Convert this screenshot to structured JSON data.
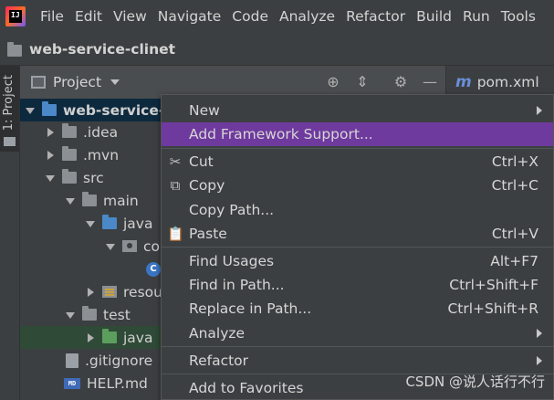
{
  "menubar": {
    "logo_text": "IJ",
    "items": [
      "File",
      "Edit",
      "View",
      "Navigate",
      "Code",
      "Analyze",
      "Refactor",
      "Build",
      "Run",
      "Tools"
    ]
  },
  "navbar": {
    "title": "web-service-clinet"
  },
  "side": {
    "tab_label": "1: Project"
  },
  "toolwindow": {
    "label": "Project"
  },
  "editor": {
    "tab_label": "pom.xml",
    "tab_icon": "m"
  },
  "tree": {
    "rows": [
      {
        "label": "web-service-c",
        "bold": true
      },
      {
        "label": ".idea"
      },
      {
        "label": ".mvn"
      },
      {
        "label": "src"
      },
      {
        "label": "main"
      },
      {
        "label": "java"
      },
      {
        "label": "co"
      },
      {
        "label": ""
      },
      {
        "label": "resou"
      },
      {
        "label": "test"
      },
      {
        "label": "java"
      },
      {
        "label": ".gitignore"
      },
      {
        "label": "HELP.md"
      }
    ]
  },
  "context_menu": {
    "items": [
      {
        "label": "New",
        "shortcut": ""
      },
      {
        "label": "Add Framework Support...",
        "shortcut": ""
      },
      {
        "label": "Cut",
        "shortcut": "Ctrl+X"
      },
      {
        "label": "Copy",
        "shortcut": "Ctrl+C"
      },
      {
        "label": "Copy Path...",
        "shortcut": ""
      },
      {
        "label": "Paste",
        "shortcut": "Ctrl+V"
      },
      {
        "label": "Find Usages",
        "shortcut": "Alt+F7"
      },
      {
        "label": "Find in Path...",
        "shortcut": "Ctrl+Shift+F"
      },
      {
        "label": "Replace in Path...",
        "shortcut": "Ctrl+Shift+R"
      },
      {
        "label": "Analyze",
        "shortcut": ""
      },
      {
        "label": "Refactor",
        "shortcut": ""
      },
      {
        "label": "Add to Favorites",
        "shortcut": ""
      }
    ]
  },
  "watermark": "CSDN @说人话行不行",
  "colors": {
    "highlight": "#6f3a9e",
    "background": "#3c3f41"
  }
}
